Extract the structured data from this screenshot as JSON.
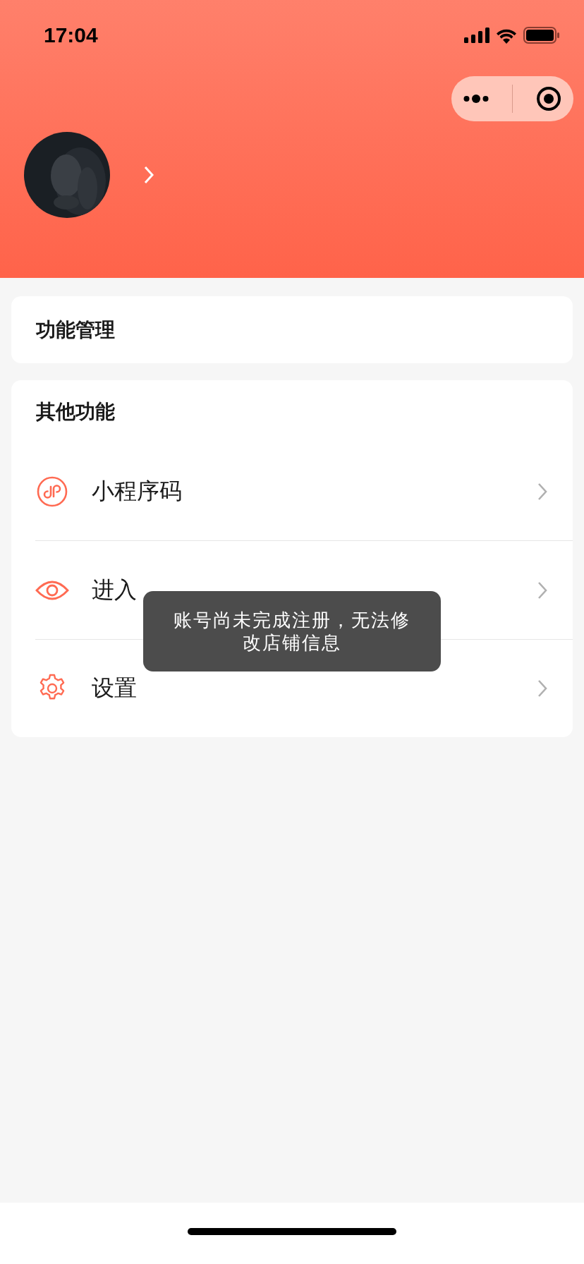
{
  "status_bar": {
    "time": "17:04"
  },
  "sections": [
    {
      "title": "功能管理"
    },
    {
      "title": "其他功能",
      "items": [
        {
          "label": "小程序码",
          "kind": "mini-program"
        },
        {
          "label": "进入",
          "kind": "eye"
        },
        {
          "label": "设置",
          "kind": "gear"
        }
      ]
    }
  ],
  "toast": {
    "message": "账号尚未完成注册，无法修改店铺信息"
  }
}
